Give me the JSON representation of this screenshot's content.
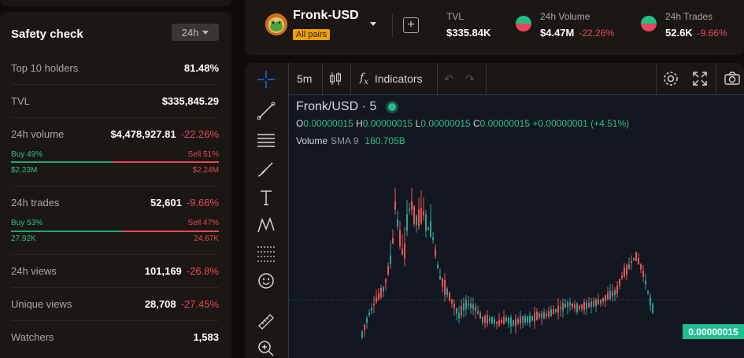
{
  "safety": {
    "title": "Safety check",
    "period": "24h",
    "top10": {
      "label": "Top 10 holders",
      "value": "81.48%"
    },
    "tvl": {
      "label": "TVL",
      "value": "$335,845.29"
    },
    "volume": {
      "label": "24h volume",
      "value": "$4,478,927.81",
      "change": "-22.26%",
      "buy_label": "Buy 49%",
      "sell_label": "Sell 51%",
      "buy_amount": "$2.23M",
      "sell_amount": "$2.24M",
      "buy_fraction": 0.49
    },
    "trades": {
      "label": "24h trades",
      "value": "52,601",
      "change": "-9.66%",
      "buy_label": "Buy 53%",
      "sell_label": "Sell 47%",
      "buy_amount": "27.92K",
      "sell_amount": "24.67K",
      "buy_fraction": 0.53
    },
    "views": {
      "label": "24h views",
      "value": "101,169",
      "change": "-26.8%"
    },
    "unique": {
      "label": "Unique views",
      "value": "28,708",
      "change": "-27.45%"
    },
    "watchers": {
      "label": "Watchers",
      "value": "1,583"
    }
  },
  "header": {
    "pair": "Fronk-USD",
    "badge": "All pairs",
    "tvl_label": "TVL",
    "tvl_value": "$335.84K",
    "vol_label": "24h Volume",
    "vol_value": "$4.47M",
    "vol_change": "-22.26%",
    "trades_label": "24h Trades",
    "trades_value": "52.6K",
    "trades_change": "-9.66%"
  },
  "toolbar": {
    "interval": "5m",
    "indicators": "Indicators"
  },
  "chart": {
    "symbol": "Fronk/USD · 5",
    "o": "0.00000015",
    "h": "0.00000015",
    "l": "0.00000015",
    "c": "0.00000015",
    "change": "+0.00000001 (+4.51%)",
    "volume_label": "Volume",
    "sma": "SMA 9",
    "volume_value": "160.705B",
    "last_price": "0.00000015"
  },
  "colors": {
    "up": "#26a69a",
    "down": "#ef5350",
    "accent": "#1fbf8e",
    "badge": "#f0a000"
  },
  "chart_data": {
    "type": "candlestick",
    "last_price": 1.5e-07
  }
}
